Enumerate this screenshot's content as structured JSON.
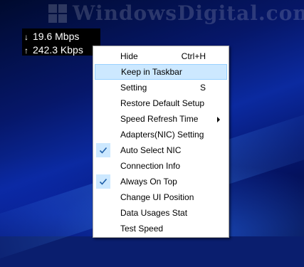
{
  "watermark": {
    "text": "WindowsDigital.com"
  },
  "speed_widget": {
    "download": {
      "arrow": "↓",
      "value": "19.6 Mbps"
    },
    "upload": {
      "arrow": "↑",
      "value": "242.3 Kbps"
    }
  },
  "context_menu": {
    "items": [
      {
        "label": "Hide",
        "shortcut": "Ctrl+H"
      },
      {
        "label": "Keep in Taskbar",
        "highlighted": true
      },
      {
        "label": "Setting",
        "shortcut": "S"
      },
      {
        "label": "Restore Default Setup"
      },
      {
        "label": "Speed Refresh Time",
        "submenu": true
      },
      {
        "label": "Adapters(NIC) Setting"
      },
      {
        "label": "Auto Select NIC",
        "checked": true
      },
      {
        "label": "Connection Info"
      },
      {
        "label": "Always On Top",
        "checked": true
      },
      {
        "label": "Change UI Position"
      },
      {
        "label": "Data Usages Stat"
      },
      {
        "label": "Test Speed"
      }
    ]
  },
  "icons": {
    "check": "checkmark-icon",
    "submenu": "chevron-right-icon",
    "download": "arrow-down-icon",
    "upload": "arrow-up-icon"
  },
  "colors": {
    "highlight_bg": "#cce8ff",
    "highlight_border": "#99d1ff",
    "check_color": "#1f5fa8",
    "widget_bg": "#000000"
  }
}
